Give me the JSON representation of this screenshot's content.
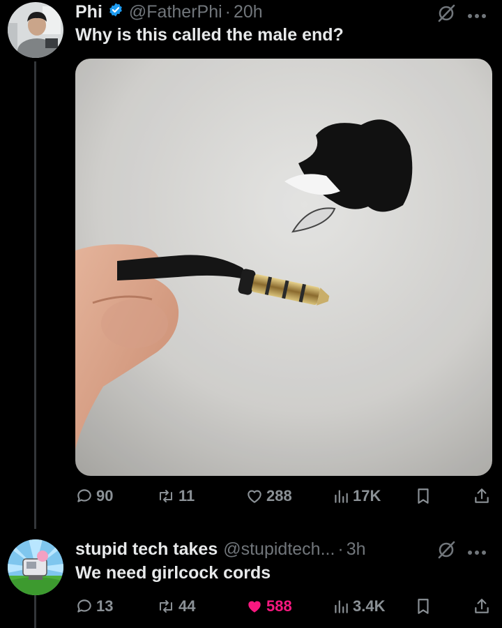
{
  "tweet": {
    "display_name": "Phi",
    "handle": "@FatherPhi",
    "separator": "·",
    "time": "20h",
    "text": "Why is this called the male end?",
    "media_icon": "photo-headphone-jack-plug",
    "actions": {
      "replies": "90",
      "reposts": "11",
      "likes": "288",
      "views": "17K"
    }
  },
  "reply": {
    "display_name": "stupid tech takes",
    "handle": "@stupidtech...",
    "separator": "·",
    "time": "3h",
    "text": "We need girlcock cords",
    "actions": {
      "replies": "13",
      "reposts": "44",
      "likes": "588",
      "views": "3.4K"
    },
    "liked": true
  },
  "colors": {
    "background": "#000000",
    "text": "#e7e9ea",
    "muted": "#71767b",
    "like_active": "#f91880",
    "verified": "#1d9bf0"
  },
  "icons": [
    "verified-badge-icon",
    "grok-icon",
    "more-icon",
    "reply-icon",
    "repost-icon",
    "like-icon",
    "views-icon",
    "bookmark-icon",
    "share-icon"
  ]
}
